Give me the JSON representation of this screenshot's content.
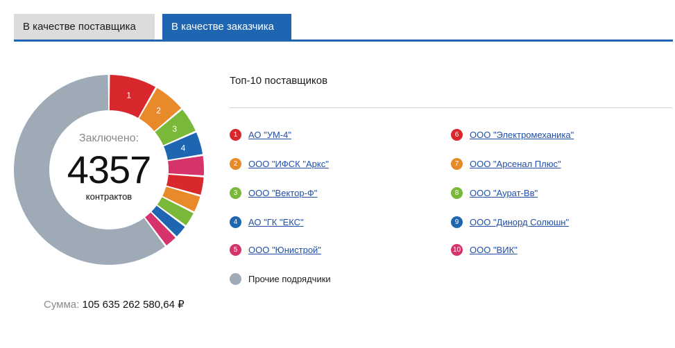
{
  "tabs": [
    {
      "label": "В качестве поставщика",
      "active": false
    },
    {
      "label": "В качестве заказчика",
      "active": true
    }
  ],
  "summary": {
    "center_title": "Заключено:",
    "center_value": "4357",
    "center_unit": "контрактов",
    "sum_label": "Сумма:",
    "sum_value": "105 635 262 580,64 ₽"
  },
  "top_title": "Топ-10 поставщиков",
  "colors": {
    "accent": "#1f66b2",
    "tab_inactive": "#dcdcdc",
    "link": "#1f4fa8",
    "other": "#9eaab5"
  },
  "suppliers": [
    {
      "num": "1",
      "name": "АО \"УМ-4\"",
      "color": "#d8282e"
    },
    {
      "num": "2",
      "name": "ООО \"ИФСК \"Аркс\"",
      "color": "#e8892a"
    },
    {
      "num": "3",
      "name": "ООО \"Вектор-Ф\"",
      "color": "#7ab83a"
    },
    {
      "num": "4",
      "name": "АО \"ГК \"ЕКС\"",
      "color": "#1f66b2"
    },
    {
      "num": "5",
      "name": "ООО \"Юнистрой\"",
      "color": "#d6336c"
    },
    {
      "num": "6",
      "name": "ООО \"Электромеханика\"",
      "color": "#d8282e"
    },
    {
      "num": "7",
      "name": "ООО \"Арсенал Плюс\"",
      "color": "#e8892a"
    },
    {
      "num": "8",
      "name": "ООО \"Аурат-Вв\"",
      "color": "#7ab83a"
    },
    {
      "num": "9",
      "name": "ООО \"Динорд Солюшн\"",
      "color": "#1f66b2"
    },
    {
      "num": "10",
      "name": "ООО \"ВИК\"",
      "color": "#d6336c"
    }
  ],
  "other_label": "Прочие подрядчики",
  "chart_data": {
    "type": "pie",
    "title": "",
    "categories": [
      "1",
      "2",
      "3",
      "4",
      "5",
      "6",
      "7",
      "8",
      "9",
      "10",
      "Прочие подрядчики"
    ],
    "values": [
      8.3,
      5.6,
      4.5,
      4.1,
      3.6,
      3.3,
      3.0,
      2.7,
      2.4,
      2.3,
      60.2
    ],
    "unit": "%",
    "slice_labels": [
      "1",
      "2",
      "3",
      "4",
      "",
      "",
      "",
      "",
      "",
      "",
      ""
    ],
    "colors": [
      "#d8282e",
      "#e8892a",
      "#7ab83a",
      "#1f66b2",
      "#d6336c",
      "#d8282e",
      "#e8892a",
      "#7ab83a",
      "#1f66b2",
      "#d6336c",
      "#9eaab5"
    ]
  }
}
